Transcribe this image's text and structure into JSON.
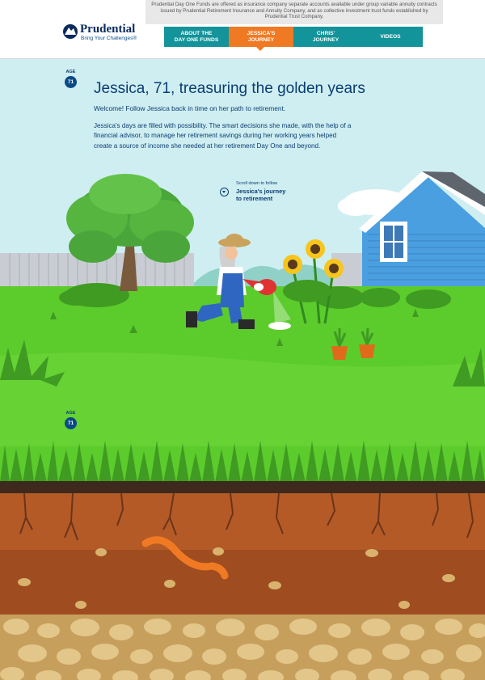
{
  "header": {
    "brand_name": "Prudential",
    "brand_tagline": "Bring Your Challenges®",
    "disclaimer": "Prudential Day One Funds are offered as insurance company separate accounts available under group variable annuity contracts issued by Prudential Retirement Insurance and Annuity Company, and as collective investment trust funds established by Prudential Trust Company."
  },
  "nav": {
    "items": [
      {
        "line1": "ABOUT THE",
        "line2": "DAY ONE FUNDS",
        "active": false
      },
      {
        "line1": "JESSICA'S",
        "line2": "JOURNEY",
        "active": true
      },
      {
        "line1": "CHRIS'",
        "line2": "JOURNEY",
        "active": false
      },
      {
        "line1": "VIDEOS",
        "line2": "",
        "active": false
      }
    ],
    "active_color": "#f07a23",
    "bar_color": "#13939a"
  },
  "age_badge": {
    "label": "AGE",
    "value": "71"
  },
  "age_badge_lower": {
    "label": "AGE",
    "value": "71"
  },
  "intro": {
    "title": "Jessica, 71, treasuring the golden years",
    "welcome": "Welcome! Follow Jessica back in time on her path to retirement.",
    "body": "Jessica's days are filled with possibility. The smart decisions she made, with the help of a financial advisor, to manage her retirement savings during her working years helped create a source of income she needed at her retirement Day One and beyond."
  },
  "scroll_hint": {
    "small": "Scroll down to follow",
    "bold_line1": "Jessica's journey",
    "bold_line2": "to retirement"
  },
  "colors": {
    "sky": "#cfeef1",
    "lawn": "#5ccb2c",
    "lawn_light": "#71d43a",
    "house": "#4a9fe0",
    "soil": "#b45a27",
    "soil_dark": "#9a4a1f",
    "gravel": "#d9b36e",
    "worm": "#f07a23"
  },
  "icons": [
    "prudential-rock-logo",
    "scroll-down-icon"
  ]
}
